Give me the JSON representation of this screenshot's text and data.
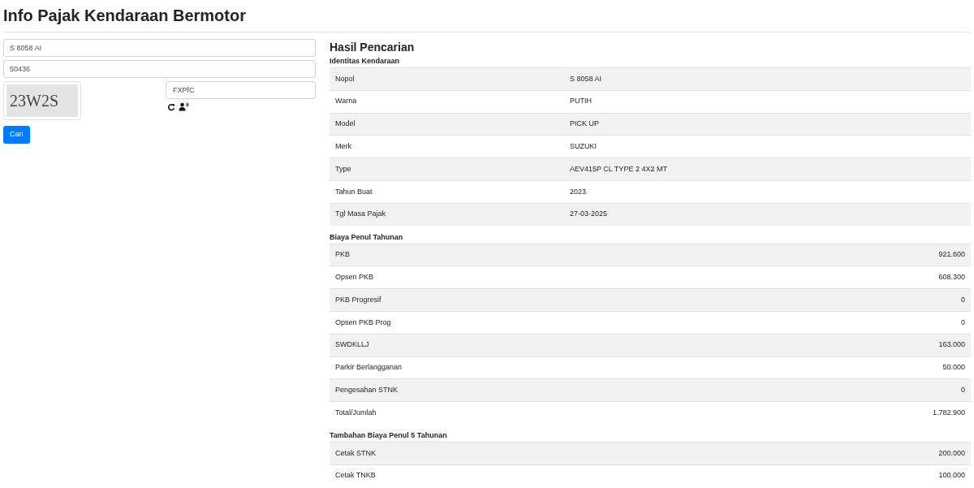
{
  "page_title": "Info Pajak Kendaraan Bermotor",
  "form": {
    "plate_value": "S 8058 AI",
    "code_value": "50436",
    "captcha_text": "23W2S",
    "captcha_answer": "FXPfC",
    "submit_label": "Cari"
  },
  "results": {
    "title": "Hasil Pencarian",
    "sections": [
      {
        "heading": "Identitas Kendaraan",
        "kind": "identity",
        "rows": [
          {
            "label": "Nopol",
            "value": "S 8058 AI"
          },
          {
            "label": "Warna",
            "value": "PUTIH"
          },
          {
            "label": "Model",
            "value": "PICK UP"
          },
          {
            "label": "Merk",
            "value": "SUZUKI"
          },
          {
            "label": "Type",
            "value": "AEV415P CL TYPE 2 4X2 MT"
          },
          {
            "label": "Tahun Buat",
            "value": "2023"
          },
          {
            "label": "Tgl Masa Pajak",
            "value": "27-03-2025"
          }
        ]
      },
      {
        "heading": "Biaya Penul Tahunan",
        "kind": "amounts",
        "rows": [
          {
            "label": "PKB",
            "value": "921.600"
          },
          {
            "label": "Opsen PKB",
            "value": "608.300"
          },
          {
            "label": "PKB Progresif",
            "value": "0"
          },
          {
            "label": "Opsen PKB Prog",
            "value": "0"
          },
          {
            "label": "SWDKLLJ",
            "value": "163.000"
          },
          {
            "label": "Parkir Berlangganan",
            "value": "50.000"
          },
          {
            "label": "Pengesahan STNK",
            "value": "0"
          },
          {
            "label": "Total/Jumlah",
            "value": "1.782.900"
          }
        ]
      },
      {
        "heading": "Tambahan Biaya Penul 5 Tahunan",
        "kind": "amounts",
        "rows": [
          {
            "label": "Cetak STNK",
            "value": "200.000"
          },
          {
            "label": "Cetak TNKB",
            "value": "100.000"
          }
        ]
      }
    ]
  }
}
